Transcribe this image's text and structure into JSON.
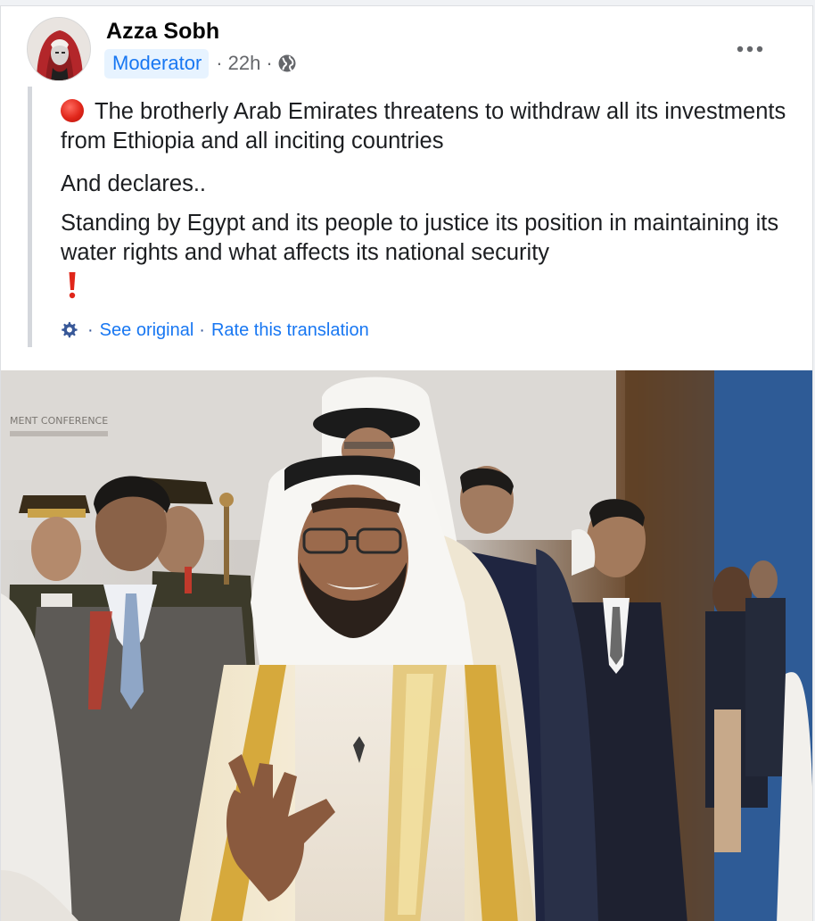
{
  "post": {
    "author": "Azza Sobh",
    "badge": "Moderator",
    "separator": "·",
    "time": "22h",
    "audience_icon": "globe-icon",
    "more_icon": "more-horizontal-icon",
    "paragraphs": {
      "p1": "The brotherly Arab Emirates threatens to withdraw all its investments from Ethiopia and all inciting countries",
      "p2": "And declares..",
      "p3": "Standing by Egypt and its people to justice its position in maintaining its water rights and what affects its national security"
    },
    "emoji": {
      "p1_prefix": "red-circle-emoji",
      "p3_suffix": "red-exclamation-emoji"
    },
    "translation": {
      "icon": "gear-icon",
      "separator": "·",
      "see_original": "See original",
      "rate": "Rate this translation"
    },
    "photo_overlay": {
      "banner_text": "MENT CONFERENCE"
    }
  },
  "colors": {
    "link": "#1877f2",
    "badge_bg": "#e7f3ff",
    "secondary_text": "#65676b",
    "body_text": "#1c1e21",
    "quote_bar": "#d4d7dc"
  }
}
